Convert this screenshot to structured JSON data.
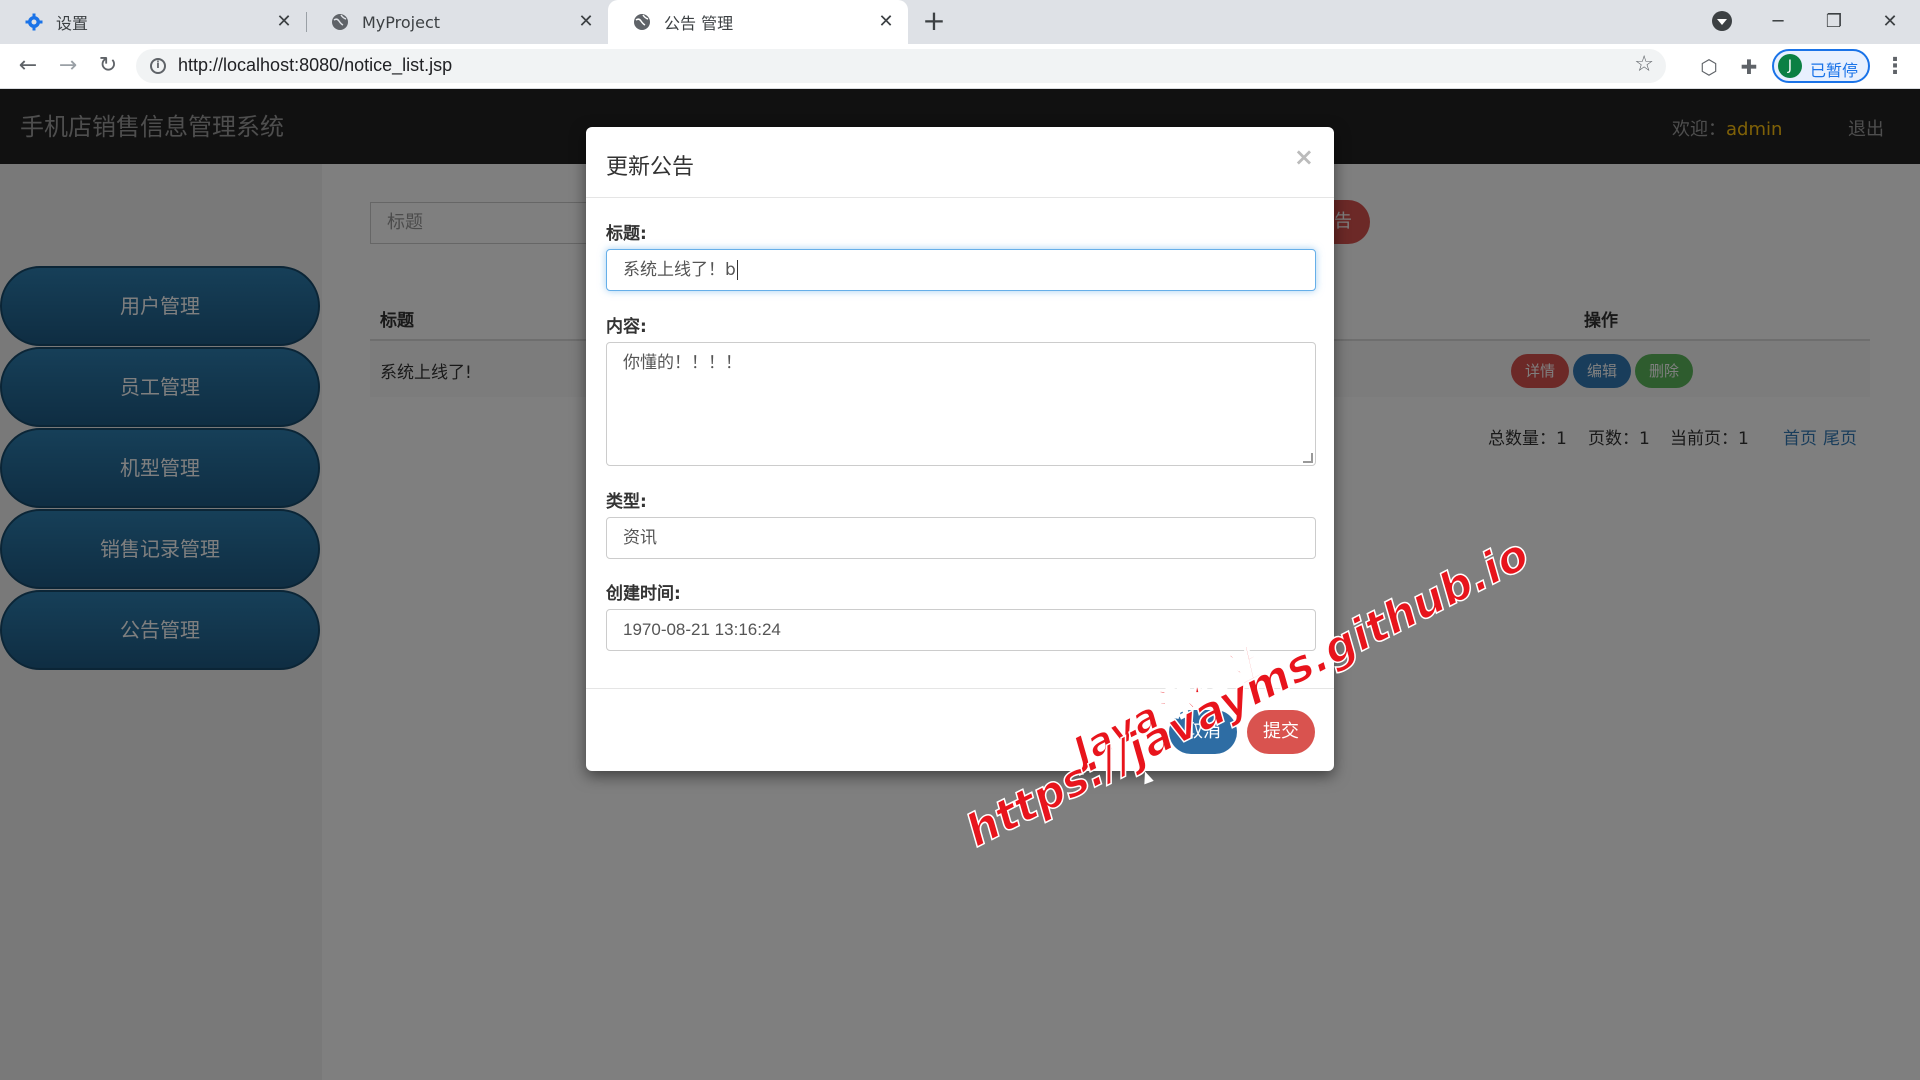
{
  "browser": {
    "tabs": [
      {
        "label": "设置",
        "favicon": "gear-icon"
      },
      {
        "label": "MyProject",
        "favicon": "globe-icon"
      },
      {
        "label": "公告 管理",
        "favicon": "globe-icon"
      }
    ],
    "url": "http://localhost:8080/notice_list.jsp",
    "profile_initial": "J",
    "profile_status": "已暂停"
  },
  "app": {
    "title": "手机店销售信息管理系统",
    "welcome_label": "欢迎：",
    "username": "admin",
    "logout_label": "退出",
    "sidebar": [
      {
        "label": "用户管理"
      },
      {
        "label": "员工管理"
      },
      {
        "label": "机型管理"
      },
      {
        "label": "销售记录管理"
      },
      {
        "label": "公告管理"
      }
    ],
    "search_placeholder": "标题",
    "add_button_label": "告",
    "table": {
      "headers": {
        "title": "标题",
        "actions": "操作"
      },
      "rows": [
        {
          "title": "系统上线了!",
          "detail_label": "详情",
          "edit_label": "编辑",
          "delete_label": "删除"
        }
      ]
    },
    "pager": {
      "total_label": "总数量：",
      "total": "1",
      "pages_label": "页数：",
      "pages": "1",
      "current_label": "当前页：",
      "current": "1",
      "first_label": "首页",
      "last_label": "尾页"
    }
  },
  "modal": {
    "title": "更新公告",
    "close_glyph": "×",
    "fields": {
      "title_label": "标题:",
      "title_value": "系统上线了！b",
      "content_label": "内容:",
      "content_value": "你懂的！！！！",
      "type_label": "类型:",
      "type_value": "资讯",
      "created_label": "创建时间:",
      "created_value": "1970-08-21 13:16:24"
    },
    "cancel_label": "取消",
    "submit_label": "提交"
  },
  "watermark": {
    "line1": "Java源码社",
    "line2": "https://javayms.github.io"
  },
  "colors": {
    "sidebar_item": "#2d7fb1",
    "danger": "#d9534f",
    "primary": "#337ab7",
    "success": "#5cb85c",
    "watermark": "#e8141c"
  }
}
